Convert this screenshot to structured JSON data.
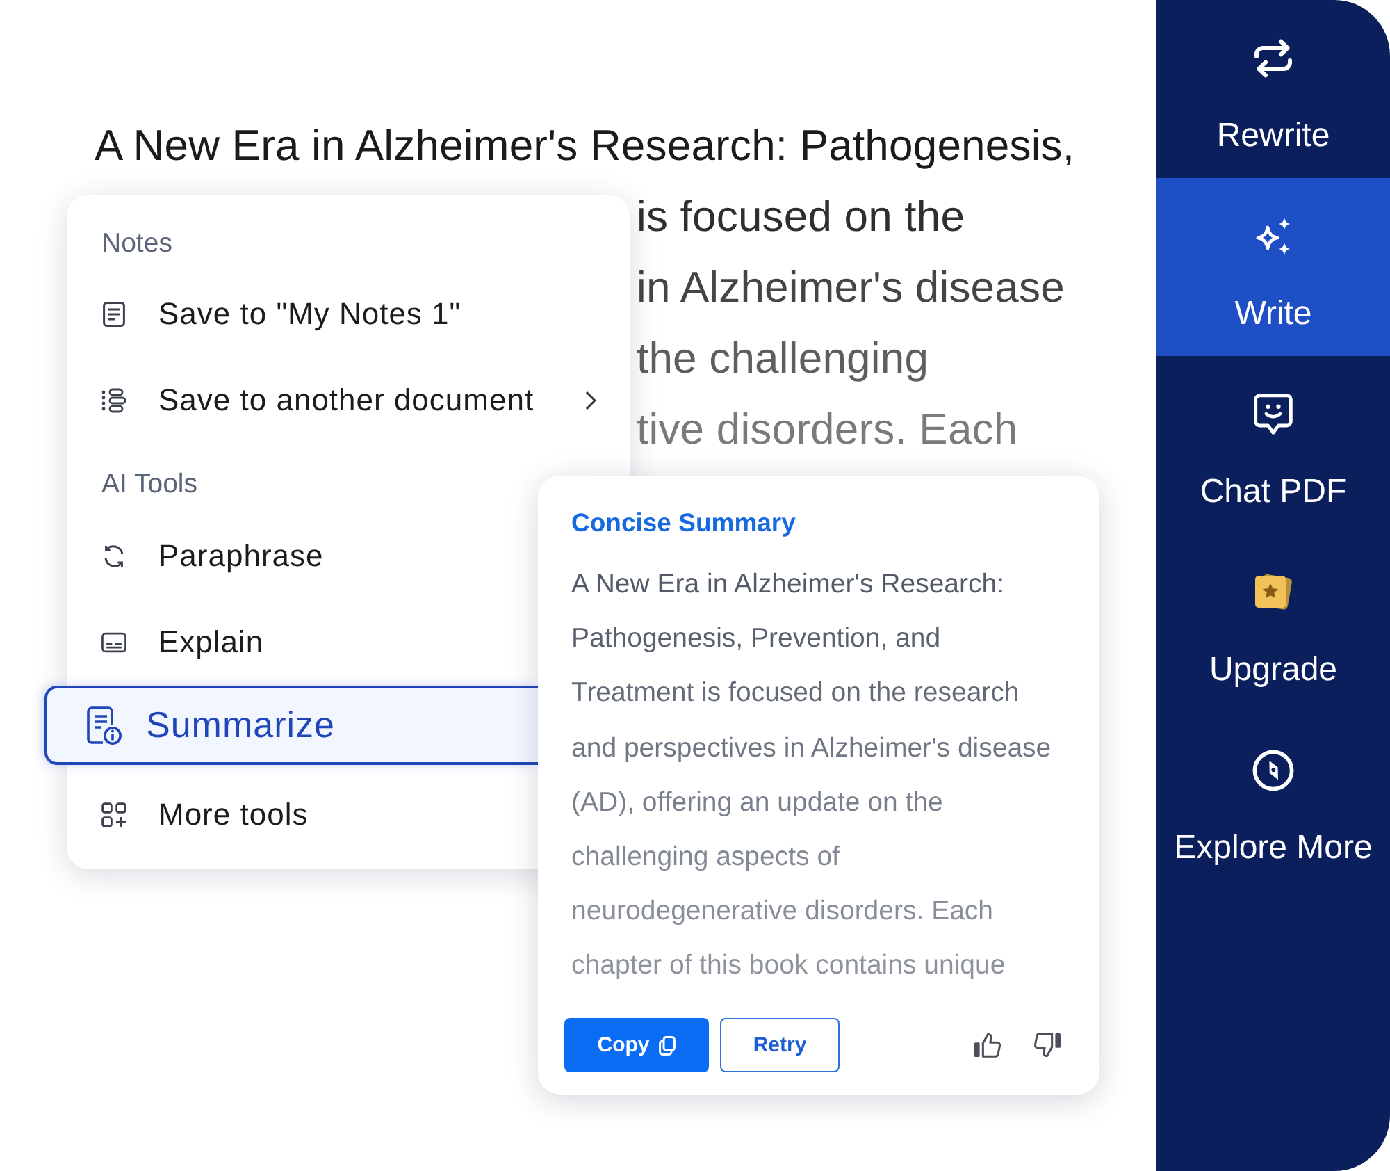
{
  "document": {
    "lines": [
      "A New Era in Alzheimer's Research: Pathogenesis,",
      "is focused on the",
      "in Alzheimer's disease",
      "the challenging",
      "tive disorders. Each"
    ]
  },
  "context_menu": {
    "sections": [
      {
        "heading": "Notes",
        "items": [
          {
            "label": "Save to \"My Notes 1\"",
            "submenu": false,
            "selected": false
          },
          {
            "label": "Save to another document",
            "submenu": true,
            "selected": false
          }
        ]
      },
      {
        "heading": "AI Tools",
        "items": [
          {
            "label": "Paraphrase",
            "submenu": false,
            "selected": false
          },
          {
            "label": "Explain",
            "submenu": false,
            "selected": false
          },
          {
            "label": "Summarize",
            "submenu": false,
            "selected": true
          },
          {
            "label": "More tools",
            "submenu": false,
            "selected": false
          }
        ]
      }
    ]
  },
  "summary_card": {
    "title": "Concise Summary",
    "text": "A New Era in Alzheimer's Research: Pathogenesis, Prevention, and Treatment is focused on the research and perspectives in Alzheimer's disease (AD), offering an update on the challenging aspects of neurodegenerative disorders. Each chapter of this book contains unique",
    "buttons": [
      {
        "label": "Copy",
        "kind": "primary"
      },
      {
        "label": "Retry",
        "kind": "outline"
      }
    ]
  },
  "sidebar": {
    "items": [
      {
        "label": "Rewrite",
        "selected": false
      },
      {
        "label": "Write",
        "selected": true
      },
      {
        "label": "Chat PDF",
        "selected": false
      },
      {
        "label": "Upgrade",
        "selected": false
      },
      {
        "label": "Explore More",
        "selected": false
      }
    ]
  }
}
